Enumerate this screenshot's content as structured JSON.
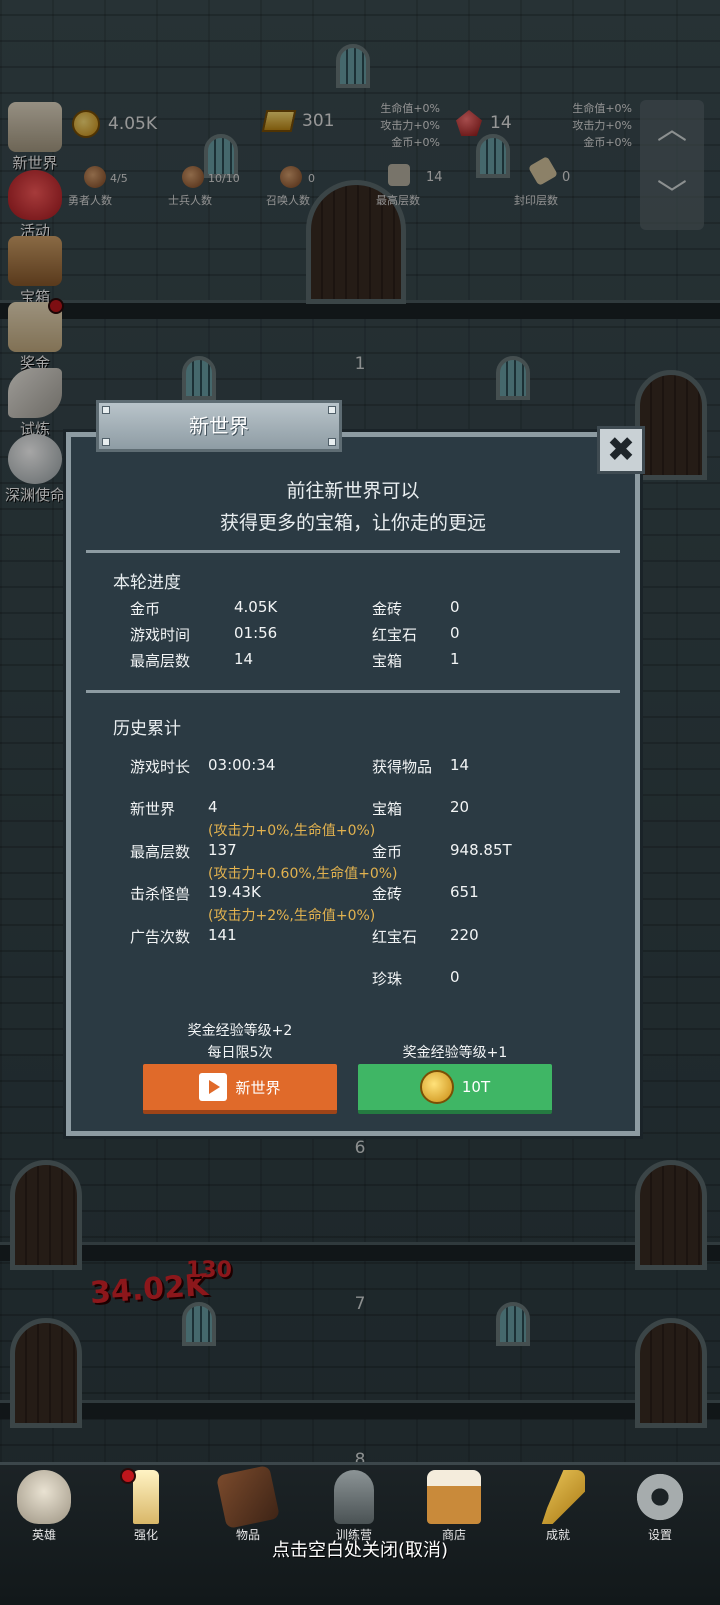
{
  "top_stats": {
    "gold": "4.05K",
    "gold_bar": "301",
    "ruby": "14",
    "gold_bonus": [
      "生命值+0%",
      "攻击力+0%",
      "金币+0%"
    ],
    "ruby_bonus": [
      "生命值+0%",
      "攻击力+0%",
      "金币+0%"
    ]
  },
  "mini_stats": [
    {
      "label": "勇者人数",
      "value": "4/5"
    },
    {
      "label": "士兵人数",
      "value": "10/10"
    },
    {
      "label": "召唤人数",
      "value": "0"
    },
    {
      "label": "最高层数",
      "value": "14"
    },
    {
      "label": "封印层数",
      "value": "0"
    }
  ],
  "left_menu": [
    "新世界",
    "活动",
    "宝箱",
    "奖金",
    "试炼",
    "深渊使命"
  ],
  "floors": [
    "1",
    "6",
    "7",
    "8"
  ],
  "damage": {
    "main": "34.02K",
    "small": "130"
  },
  "dialog": {
    "tab_title": "新世界",
    "intro_line1": "前往新世界可以",
    "intro_line2": "获得更多的宝箱，让你走的更远",
    "round_title": "本轮进度",
    "round": [
      {
        "label": "金币",
        "value": "4.05K"
      },
      {
        "label": "金砖",
        "value": "0"
      },
      {
        "label": "游戏时间",
        "value": "01:56"
      },
      {
        "label": "红宝石",
        "value": "0"
      },
      {
        "label": "最高层数",
        "value": "14"
      },
      {
        "label": "宝箱",
        "value": "1"
      }
    ],
    "history_title": "历史累计",
    "history": [
      {
        "label": "游戏时长",
        "value": "03:00:34"
      },
      {
        "label": "获得物品",
        "value": "14"
      },
      {
        "label": "新世界",
        "value": "4"
      },
      {
        "label": "宝箱",
        "value": "20"
      },
      {
        "label": "最高层数",
        "value": "137"
      },
      {
        "label": "金币",
        "value": "948.85T"
      },
      {
        "label": "击杀怪兽",
        "value": "19.43K"
      },
      {
        "label": "金砖",
        "value": "651"
      },
      {
        "label": "广告次数",
        "value": "141"
      },
      {
        "label": "红宝石",
        "value": "220"
      },
      {
        "label": "珍珠",
        "value": "0"
      }
    ],
    "notes": [
      "(攻击力+0%,生命值+0%)",
      "(攻击力+0.60%,生命值+0%)",
      "(攻击力+2%,生命值+0%)"
    ],
    "left_caption_1": "奖金经验等级+2",
    "left_caption_2": "每日限5次",
    "right_caption": "奖金经验等级+1",
    "btn_new_world": "新世界",
    "btn_coin": "10T",
    "close_symbol": "✖"
  },
  "bottom_nav": [
    "英雄",
    "强化",
    "物品",
    "训练营",
    "商店",
    "成就",
    "设置"
  ],
  "close_hint": "点击空白处关闭(取消)"
}
